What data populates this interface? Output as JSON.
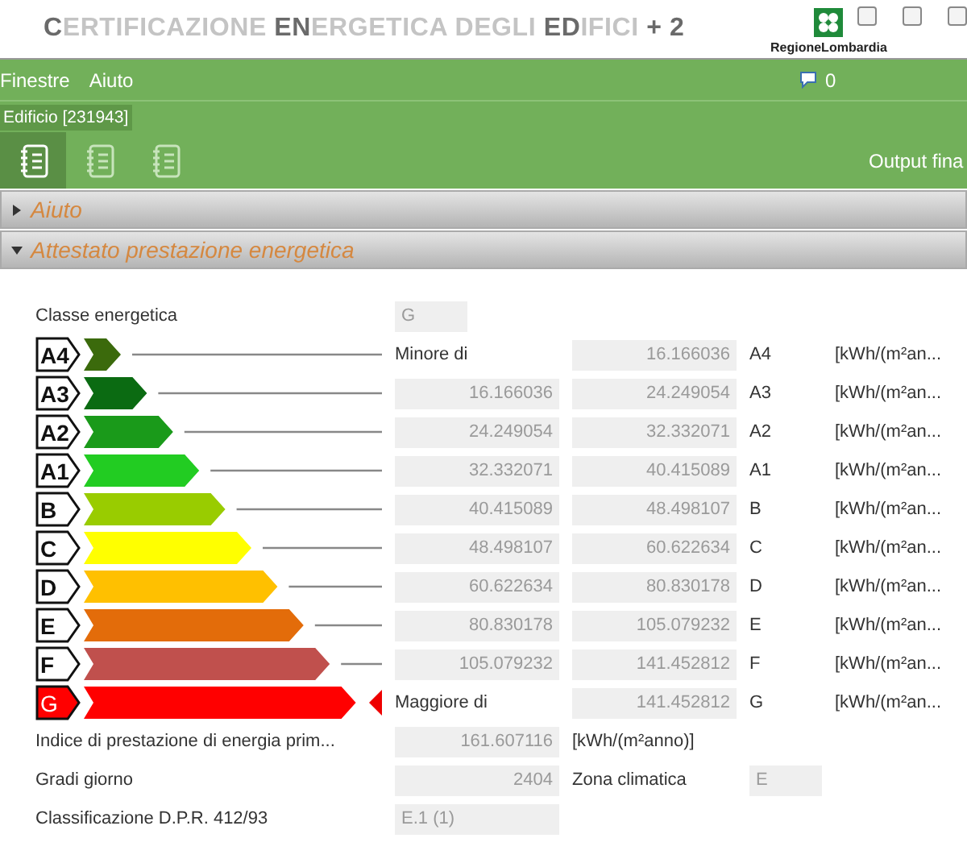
{
  "window": {
    "title": "**C**ERTIFICAZIONE **EN**ERGETICA DEGLI **ED**IFICI **+ 2**",
    "logo_text": "RegioneLombardia"
  },
  "menu": [
    "Finestre",
    "Aiuto"
  ],
  "messages": {
    "count": "0"
  },
  "document_tab": {
    "label": "Edificio [231943]"
  },
  "toolbar": {
    "tools": [
      {
        "selected": true
      },
      {
        "selected": false
      },
      {
        "selected": false
      }
    ],
    "right_label": "Output fina"
  },
  "sections": [
    {
      "title": "Aiuto",
      "expanded": false
    },
    {
      "title": "Attestato prestazione energetica",
      "expanded": true
    }
  ],
  "energy_class": {
    "label": "Classe energetica",
    "value": "G"
  },
  "classes": [
    {
      "label": "A4",
      "color": "#3b6a0c",
      "selected": false,
      "from_label": "Minore di",
      "to": "16.166036",
      "class_label": "A4",
      "unit": "[kWh/(m²an..."
    },
    {
      "label": "A3",
      "color": "#0b6b12",
      "selected": false,
      "from": "16.166036",
      "to": "24.249054",
      "class_label": "A3",
      "unit": "[kWh/(m²an..."
    },
    {
      "label": "A2",
      "color": "#1a9a1a",
      "selected": false,
      "from": "24.249054",
      "to": "32.332071",
      "class_label": "A2",
      "unit": "[kWh/(m²an..."
    },
    {
      "label": "A1",
      "color": "#22cc22",
      "selected": false,
      "from": "32.332071",
      "to": "40.415089",
      "class_label": "A1",
      "unit": "[kWh/(m²an..."
    },
    {
      "label": "B",
      "color": "#99cc00",
      "selected": false,
      "from": "40.415089",
      "to": "48.498107",
      "class_label": "B",
      "unit": "[kWh/(m²an..."
    },
    {
      "label": "C",
      "color": "#ffff00",
      "selected": false,
      "from": "48.498107",
      "to": "60.622634",
      "class_label": "C",
      "unit": "[kWh/(m²an..."
    },
    {
      "label": "D",
      "color": "#ffc000",
      "selected": false,
      "from": "60.622634",
      "to": "80.830178",
      "class_label": "D",
      "unit": "[kWh/(m²an..."
    },
    {
      "label": "E",
      "color": "#e36c0a",
      "selected": false,
      "from": "80.830178",
      "to": "105.079232",
      "class_label": "E",
      "unit": "[kWh/(m²an..."
    },
    {
      "label": "F",
      "color": "#c0504d",
      "selected": false,
      "from": "105.079232",
      "to": "141.452812",
      "class_label": "F",
      "unit": "[kWh/(m²an..."
    },
    {
      "label": "G",
      "color": "#ff0000",
      "selected": true,
      "from_label": "Maggiore di",
      "to": "141.452812",
      "class_label": "G",
      "unit": "[kWh/(m²an..."
    }
  ],
  "indice": {
    "label": "Indice di prestazione di energia prim...",
    "value": "161.607116",
    "unit": "[kWh/(m²anno)]"
  },
  "gradi_giorno": {
    "label": "Gradi giorno",
    "value": "2404",
    "zone_label": "Zona climatica",
    "zone_value": "E"
  },
  "classificazione": {
    "label": "Classificazione D.P.R. 412/93",
    "value": "E.1 (1)"
  }
}
